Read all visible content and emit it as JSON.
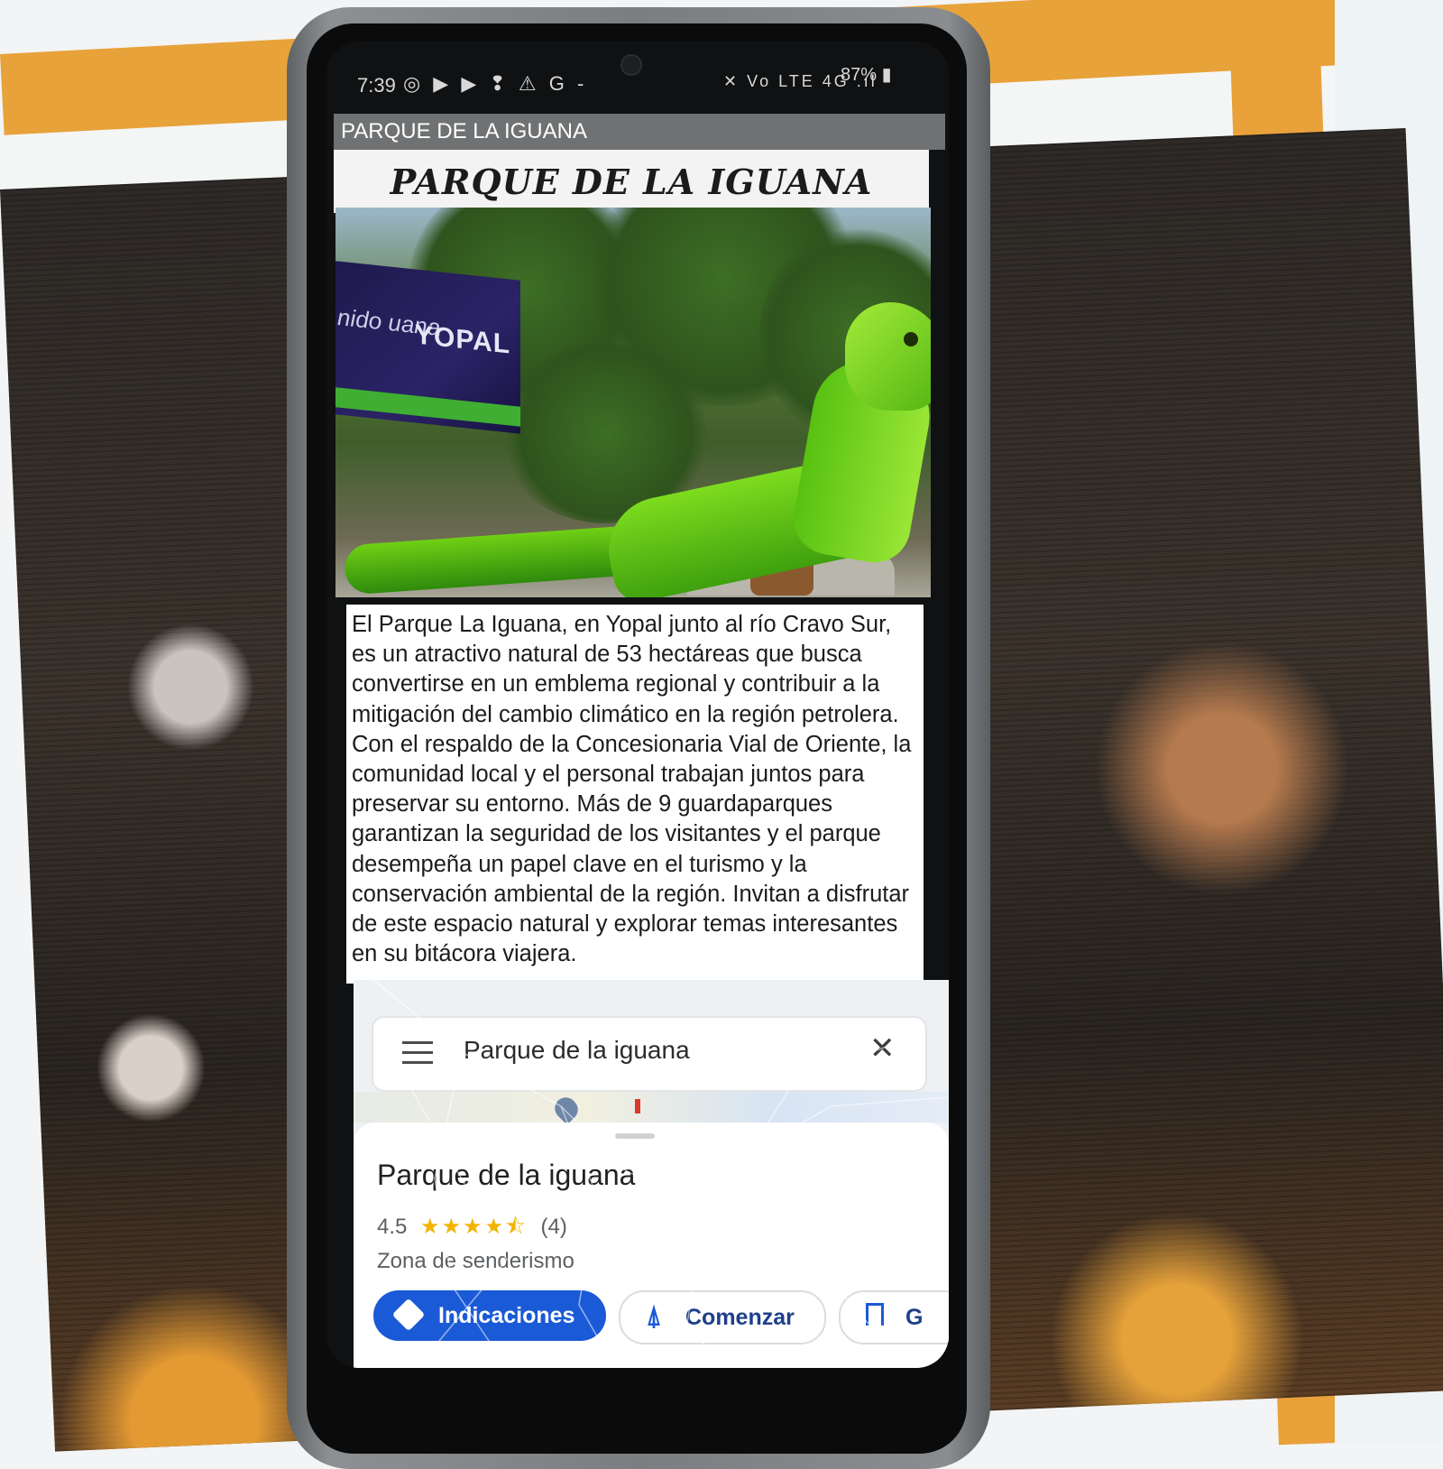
{
  "status_bar": {
    "time": "7:39",
    "left_icons": "◎ ▶ ▶ ❢ ⚠ G -",
    "right_icons": "✕ Vo LTE 4G .ıl",
    "battery": "87% ▮"
  },
  "website": {
    "header_label": "PARQUE DE LA IGUANA",
    "title": "PARQUE DE LA IGUANA",
    "hero_sign_text": "YOPAL",
    "hero_sign_text_left": "nido uana",
    "article": "El Parque La Iguana, en Yopal junto al río Cravo Sur, es un atractivo natural de 53 hectáreas que busca convertirse en un emblema regional y contribuir a la mitigación del cambio climático en la región petrolera. Con el respaldo de la Concesionaria Vial de Oriente, la comunidad local y el personal trabajan juntos para preservar su entorno. Más de 9 guardaparques garantizan la seguridad de los visitantes y el parque desempeña un papel clave en el turismo y la conservación ambiental de la región. Invitan a disfrutar de este espacio natural y explorar temas interesantes en su bitácora viajera."
  },
  "maps": {
    "search_value": "Parque de la iguana",
    "place_name": "Parque de la iguana",
    "rating": "4.5",
    "stars": "★★★★⯪",
    "review_count": "(4)",
    "category": "Zona de senderismo",
    "btn_directions": "Indicaciones",
    "btn_start": "Comenzar",
    "btn_save": "G",
    "accent_color": "#1a5ad6"
  },
  "icons": {
    "menu": "menu-icon",
    "close": "close-icon",
    "directions": "directions-icon",
    "navigate": "navigate-arrow-icon",
    "bookmark": "bookmark-icon"
  }
}
